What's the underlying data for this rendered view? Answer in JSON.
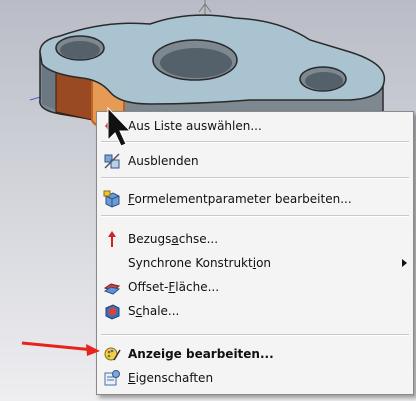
{
  "context_menu": {
    "items": [
      {
        "label_pre": "Aus Liste auswählen...",
        "label_u": "",
        "label_post": "",
        "icon": "select-from-list-icon"
      },
      {
        "label_pre": "Ausblenden",
        "label_u": "",
        "label_post": "",
        "icon": "hide-icon"
      },
      {
        "label_pre": "",
        "label_u": "F",
        "label_post": "ormelementparameter bearbeiten...",
        "icon": "edit-feature-parameters-icon"
      },
      {
        "label_pre": "Bezugs",
        "label_u": "a",
        "label_post": "chse...",
        "icon": "datum-axis-icon"
      },
      {
        "label_pre": "Synchrone Konstrukt",
        "label_u": "i",
        "label_post": "on",
        "icon": ""
      },
      {
        "label_pre": "Offset-",
        "label_u": "F",
        "label_post": "läche...",
        "icon": "offset-face-icon"
      },
      {
        "label_pre": "S",
        "label_u": "c",
        "label_post": "hale...",
        "icon": "shell-icon"
      },
      {
        "label_pre": "Anzeige bearbeiten...",
        "label_u": "",
        "label_post": "",
        "icon": "edit-display-icon"
      },
      {
        "label_pre": "",
        "label_u": "E",
        "label_post": "igenschaften",
        "icon": "properties-icon"
      }
    ]
  },
  "colors": {
    "menu_bg": "#f4f4f4",
    "part_face_top": "#a9c4d0",
    "part_side": "#7b8790",
    "highlight_face": "#e59a56",
    "annotation_arrow": "#e8231c"
  }
}
